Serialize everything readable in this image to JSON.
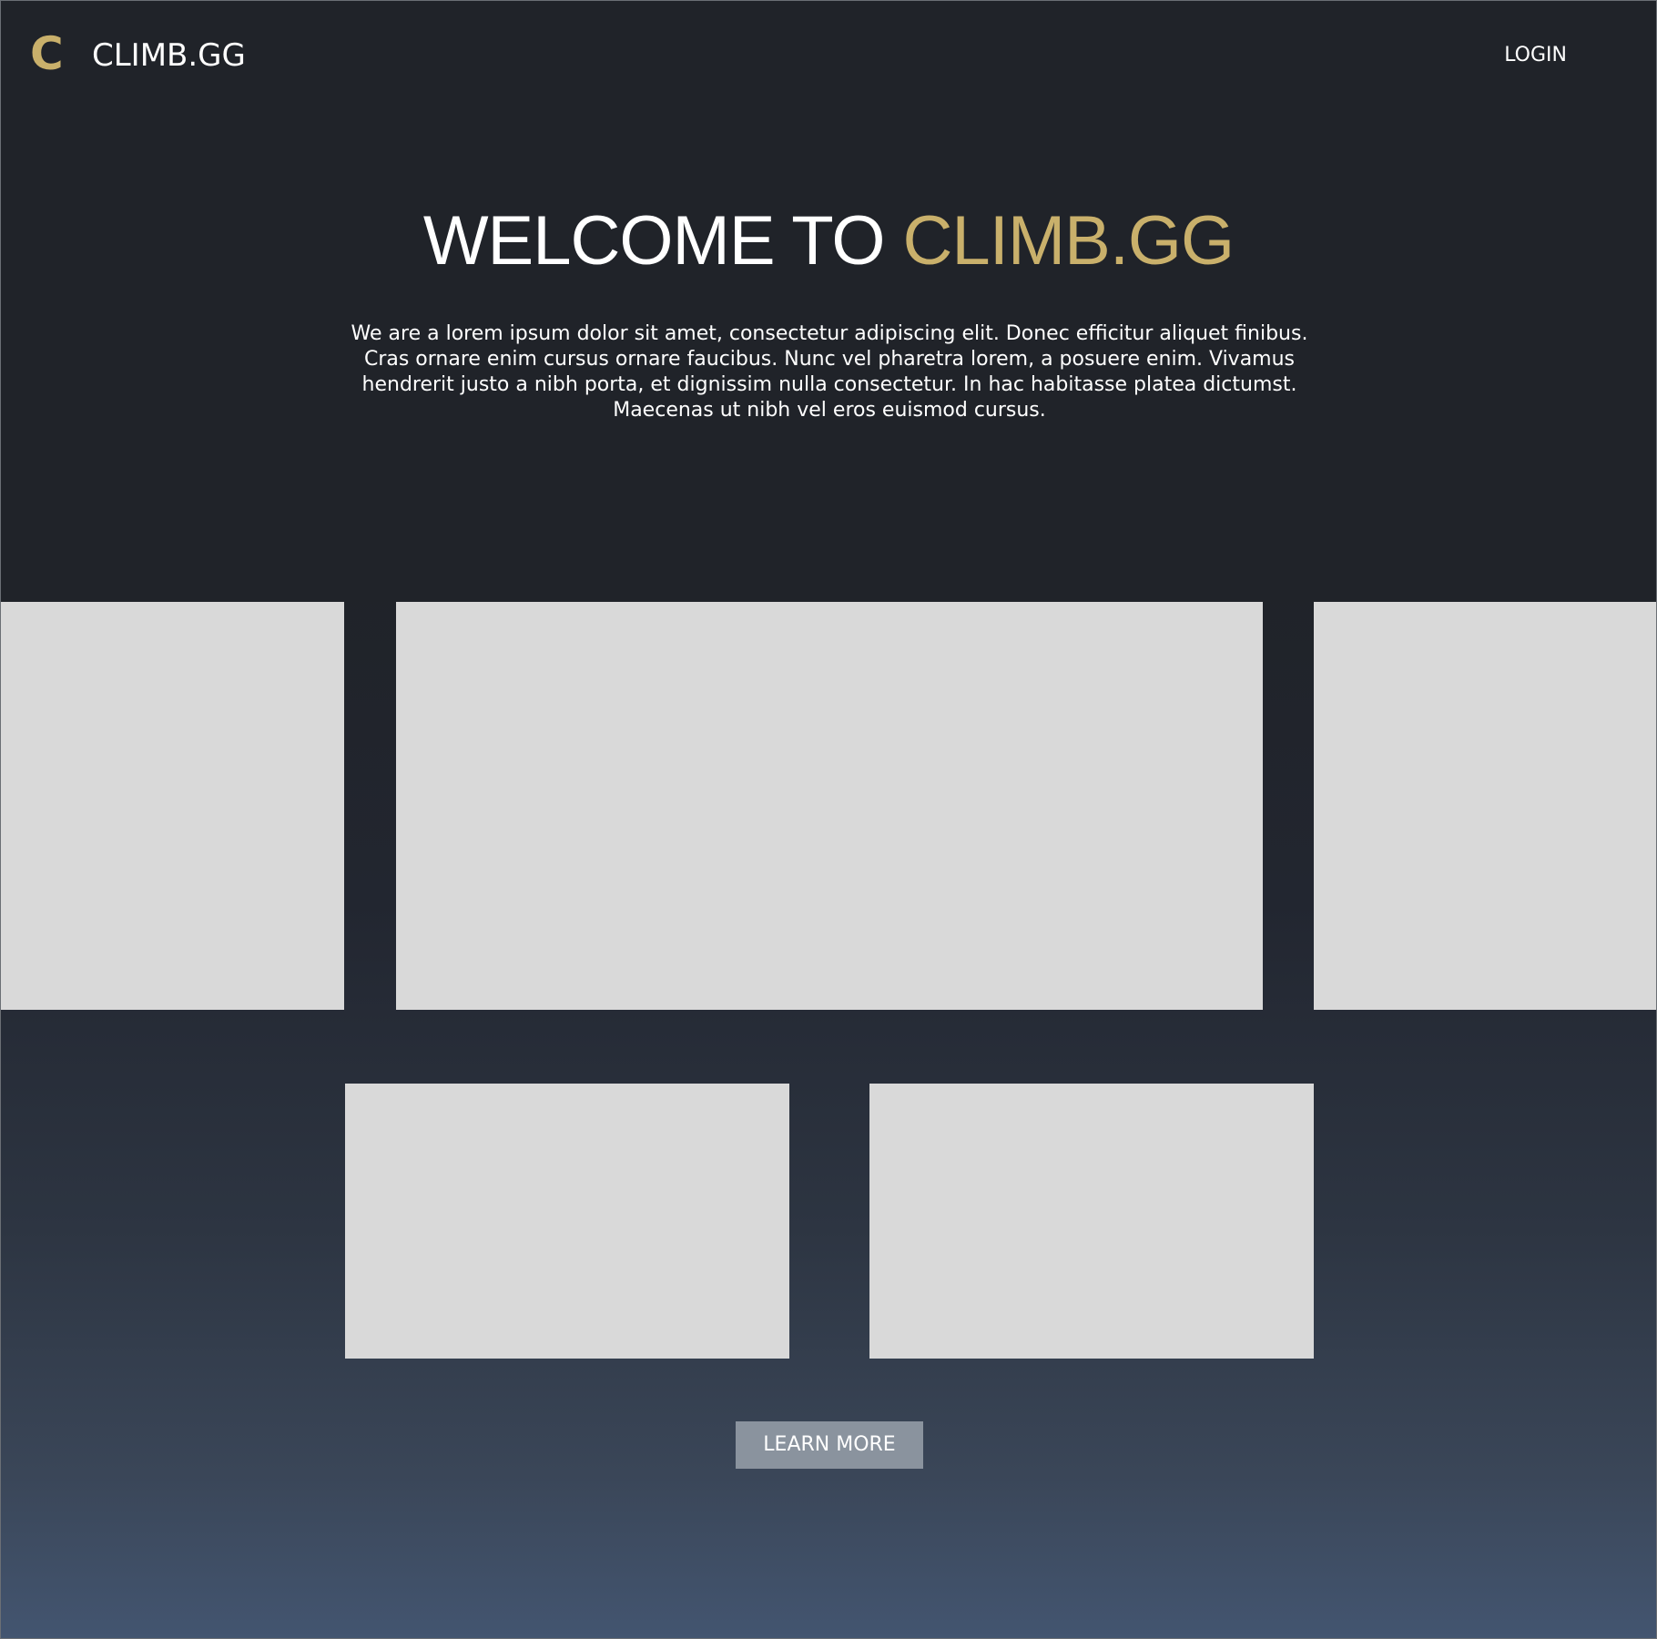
{
  "header": {
    "logo_mark": "C",
    "logo_text": "CLIMB.GG",
    "login_label": "LOGIN"
  },
  "hero": {
    "title_prefix": "WELCOME TO ",
    "title_accent": "CLIMB.GG",
    "description": "We are a lorem ipsum dolor sit amet, consectetur adipiscing elit. Donec efficitur aliquet finibus. Cras ornare enim cursus ornare faucibus. Nunc vel pharetra lorem, a posuere enim. Vivamus hendrerit justo a nibh porta, et dignissim nulla consectetur. In hac habitasse platea dictumst. Maecenas ut nibh vel eros euismod cursus."
  },
  "actions": {
    "learn_more_label": "LEARN MORE"
  },
  "colors": {
    "accent": "#c9b06b",
    "background_top": "#202329",
    "background_bottom": "#435570",
    "placeholder": "#d9d9d9",
    "button": "#8a939e"
  }
}
